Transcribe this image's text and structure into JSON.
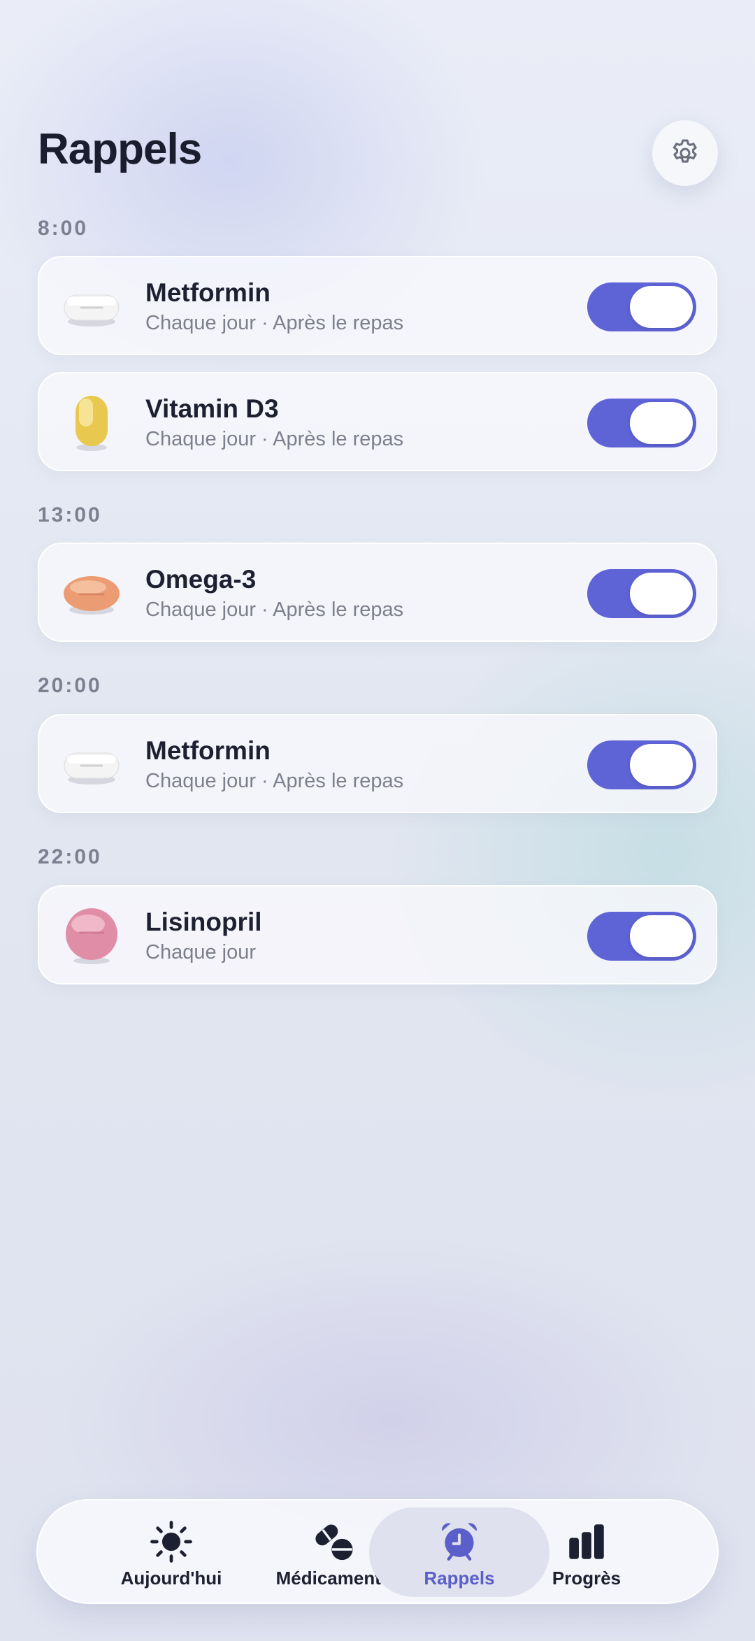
{
  "header": {
    "title": "Rappels",
    "settings_icon": "gear-icon"
  },
  "colors": {
    "accent": "#5e63d6",
    "title": "#1a1d2e",
    "muted": "#7d808c"
  },
  "groups": [
    {
      "time": "8:00",
      "items": [
        {
          "name": "Metformin",
          "detail": "Chaque jour · Après le repas",
          "icon": "white-capsule-pill-icon",
          "enabled": true
        },
        {
          "name": "Vitamin D3",
          "detail": "Chaque jour · Après le repas",
          "icon": "yellow-softgel-pill-icon",
          "enabled": true
        }
      ]
    },
    {
      "time": "13:00",
      "items": [
        {
          "name": "Omega-3",
          "detail": "Chaque jour · Après le repas",
          "icon": "orange-oval-pill-icon",
          "enabled": true
        }
      ]
    },
    {
      "time": "20:00",
      "items": [
        {
          "name": "Metformin",
          "detail": "Chaque jour · Après le repas",
          "icon": "white-capsule-pill-icon",
          "enabled": true
        }
      ]
    },
    {
      "time": "22:00",
      "items": [
        {
          "name": "Lisinopril",
          "detail": "Chaque jour",
          "icon": "pink-round-pill-icon",
          "enabled": true
        }
      ]
    }
  ],
  "tabbar": {
    "tabs": [
      {
        "label": "Aujourd'hui",
        "icon": "sun-icon",
        "active": false
      },
      {
        "label": "Médicaments",
        "icon": "pills-icon",
        "active": false
      },
      {
        "label": "Rappels",
        "icon": "alarm-clock-icon",
        "active": true
      },
      {
        "label": "Progrès",
        "icon": "bar-chart-icon",
        "active": false
      }
    ]
  }
}
